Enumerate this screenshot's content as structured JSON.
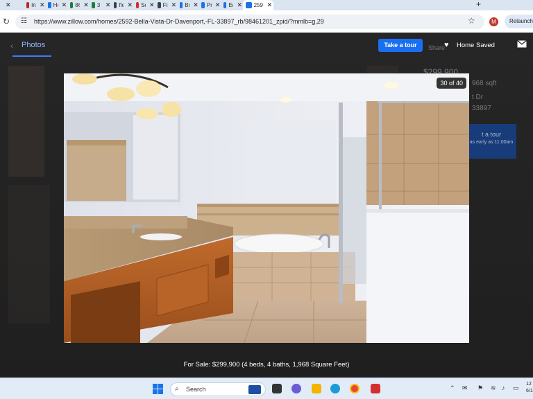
{
  "browser": {
    "tabs": [
      {
        "label": "x",
        "color": "#9aa0a6"
      },
      {
        "label": "Inbo",
        "color": "#c5221f"
      },
      {
        "label": "Hon",
        "color": "#1a73e8"
      },
      {
        "label": "861",
        "color": "#188038"
      },
      {
        "label": "3 Cl",
        "color": "#188038"
      },
      {
        "label": "flex",
        "color": "#3c4043"
      },
      {
        "label": "Sele",
        "color": "#d93025"
      },
      {
        "label": "Find",
        "color": "#3c4043"
      },
      {
        "label": "Busi",
        "color": "#1a73e8"
      },
      {
        "label": "Prop",
        "color": "#1a73e8"
      },
      {
        "label": "Edit",
        "color": "#1a73e8"
      },
      {
        "label": "259",
        "color": "#1a73e8",
        "active": true
      }
    ],
    "new_tab": "+",
    "url": "https://www.zillow.com/homes/2592-Bella-Vista-Dr-Davenport,-FL-33897_rb/98461201_zpid/?mmlb=g,29",
    "profile_initial": "M",
    "relaunch_label": "Relaunch t"
  },
  "viewer": {
    "photos_tab": "Photos",
    "take_tour_label": "Take a tour",
    "home_saved_label": "Home Saved",
    "counter": "30 of 40",
    "caption": "For Sale: $299,900 (4 beds, 4 baths, 1,968 Square Feet)"
  },
  "background_listing": {
    "price": "$299,900",
    "sqft": "968 sqft",
    "street_tail": "t Dr",
    "zip": "33897",
    "tour_title": "t a tour",
    "tour_sub": "as early as 11:00am",
    "share": "Share"
  },
  "taskbar": {
    "search_placeholder": "Search",
    "clock_time": "12",
    "clock_date": "6/1"
  }
}
